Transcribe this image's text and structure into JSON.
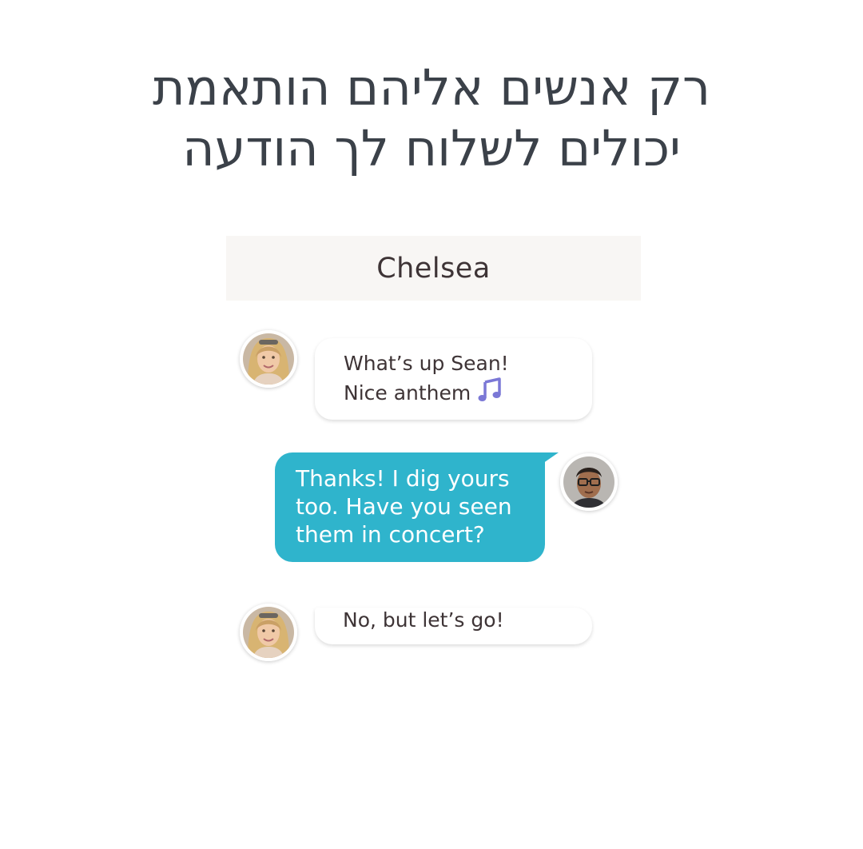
{
  "headline": {
    "line1": "רק אנשים אליהם הותאמת",
    "line2": "יכולים לשלוח לך הודעה"
  },
  "chat": {
    "contact_name": "Chelsea",
    "messages": [
      {
        "sender": "Chelsea",
        "direction": "incoming",
        "line1": "What’s up Sean!",
        "line2": "Nice anthem",
        "icon": "music-note-icon"
      },
      {
        "sender": "Sean",
        "direction": "outgoing",
        "line1": "Thanks! I dig yours",
        "line2": "too. Have you seen",
        "line3": "them in concert?"
      },
      {
        "sender": "Chelsea",
        "direction": "incoming",
        "line1": "No, but let’s go!"
      }
    ]
  },
  "colors": {
    "headline_text": "#3b4149",
    "header_background": "#f8f6f4",
    "outgoing_bubble": "#2fb4cc",
    "incoming_bubble": "#ffffff",
    "message_text": "#3e3436",
    "music_note": "#7b78d6"
  }
}
